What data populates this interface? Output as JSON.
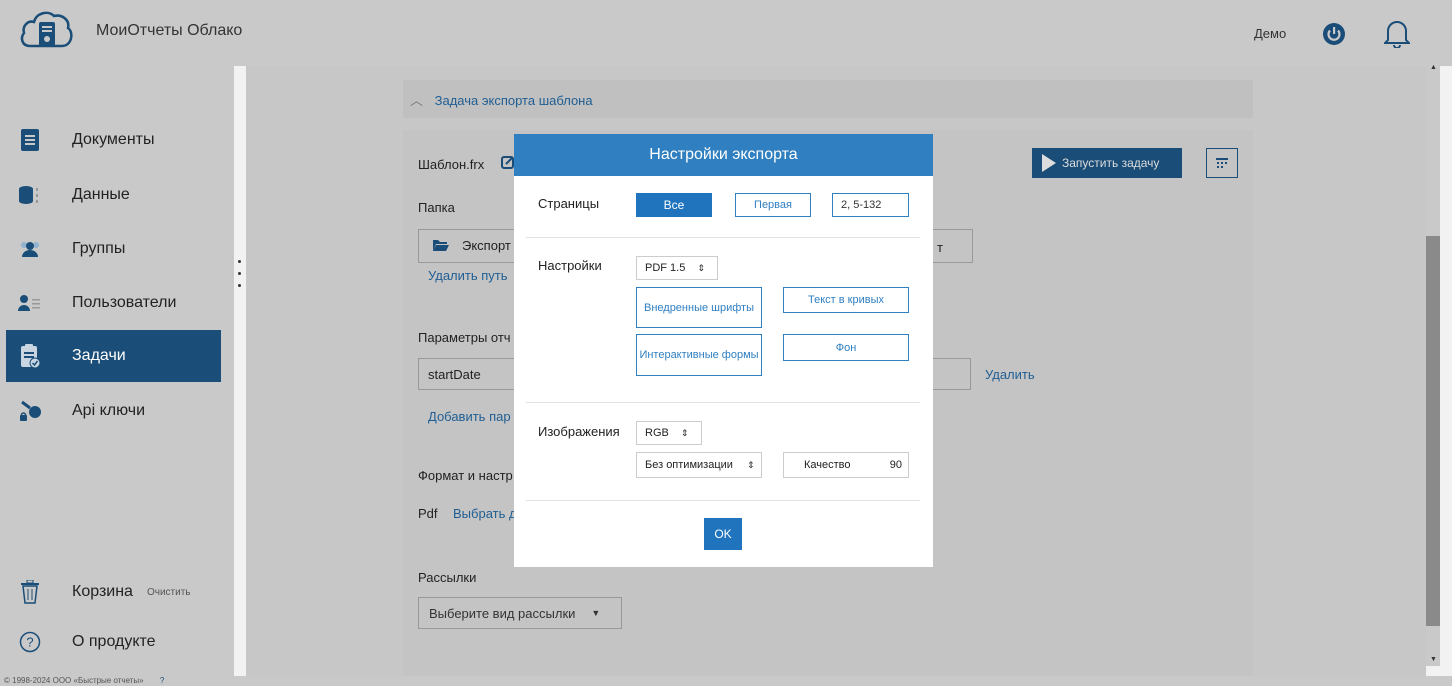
{
  "header": {
    "app_title": "МоиОтчеты Облако",
    "user_name": "Демо"
  },
  "sidebar": {
    "items": [
      {
        "label": "Документы",
        "icon": "document-icon"
      },
      {
        "label": "Данные",
        "icon": "database-icon"
      },
      {
        "label": "Группы",
        "icon": "users-group-icon"
      },
      {
        "label": "Пользователи",
        "icon": "user-list-icon"
      },
      {
        "label": "Задачи",
        "icon": "tasks-icon",
        "active": true
      },
      {
        "label": "Api ключи",
        "icon": "api-key-icon"
      }
    ],
    "trash_label": "Корзина",
    "trash_clear": "Очистить",
    "about_label": "О продукте"
  },
  "footer": {
    "copyright": "© 1998-2024 ООО «Быстрые отчеты»"
  },
  "task": {
    "section_title": "Задача экспорта шаблона",
    "template_name": "Шаблон.frx",
    "folder_label": "Папка",
    "folder_value": "Экспорт",
    "folder_suffix": "т",
    "remove_path": "Удалить путь",
    "params_label": "Параметры отч",
    "param_name": "startDate",
    "param_remove": "Удалить",
    "add_param": "Добавить пар",
    "format_label": "Формат и настр",
    "format_value": "Pdf",
    "format_choose": "Выбрать д",
    "mailing_label": "Рассылки",
    "mailing_select": "Выберите вид рассылки",
    "run_button": "Запустить задачу"
  },
  "modal": {
    "title": "Настройки экспорта",
    "pages_label": "Страницы",
    "pages_all": "Все",
    "pages_first": "Первая",
    "pages_range": "2, 5-132",
    "settings_label": "Настройки",
    "pdf_version": "PDF 1.5",
    "embedded_fonts": "Внедренные шрифты",
    "text_curves": "Текст в кривых",
    "interactive_forms": "Интерактивные формы",
    "background": "Фон",
    "images_label": "Изображения",
    "color_mode": "RGB",
    "optimization": "Без оптимизации",
    "quality_label": "Качество",
    "quality_value": "90",
    "ok_button": "OK"
  },
  "colors": {
    "modal_header": "#2f7fc1",
    "active_nav": "#1a4d78",
    "link": "#1f5e93"
  }
}
